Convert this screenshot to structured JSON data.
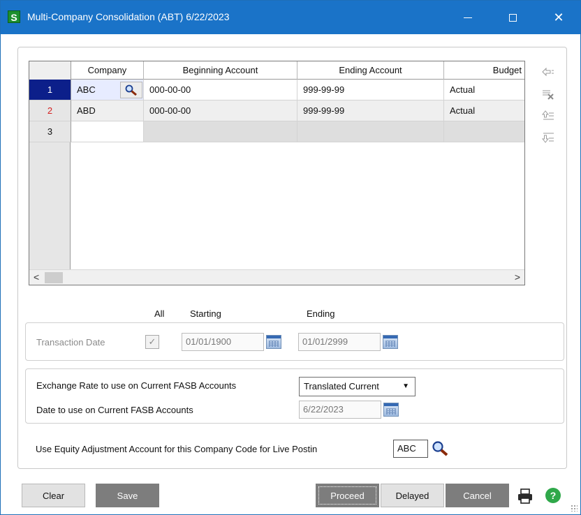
{
  "window": {
    "app_icon_letter": "S",
    "title": "Multi-Company Consolidation (ABT) 6/22/2023",
    "minimize_icon": "minimize-icon",
    "maximize_icon": "maximize-icon",
    "close_glyph": "✕"
  },
  "grid": {
    "columns": [
      "Company",
      "Beginning Account",
      "Ending Account",
      "Budget"
    ],
    "rows": [
      {
        "num": "1",
        "company": "ABC",
        "begin": "000-00-00",
        "end": "999-99-99",
        "budget": "Actual"
      },
      {
        "num": "2",
        "company": "ABD",
        "begin": "000-00-00",
        "end": "999-99-99",
        "budget": "Actual"
      },
      {
        "num": "3",
        "company": "",
        "begin": "",
        "end": "",
        "budget": ""
      }
    ],
    "scroll_left": "<",
    "scroll_right": ">"
  },
  "side_tools": [
    "insert-row-icon",
    "delete-row-icon",
    "move-up-icon",
    "move-down-icon"
  ],
  "date_section": {
    "col_all": "All",
    "col_starting": "Starting",
    "col_ending": "Ending",
    "label": "Transaction Date",
    "all_checked": true,
    "check_glyph": "✓",
    "starting": "01/01/1900",
    "ending": "01/01/2999"
  },
  "fasb": {
    "exchange_label": "Exchange Rate to use on Current FASB Accounts",
    "exchange_value": "Translated Current",
    "date_label": "Date to use on Current FASB Accounts",
    "date_value": "6/22/2023"
  },
  "equity": {
    "label": "Use Equity Adjustment Account for this Company Code for Live Postin",
    "value": "ABC"
  },
  "buttons": {
    "clear": "Clear",
    "save": "Save",
    "proceed": "Proceed",
    "delayed": "Delayed",
    "cancel": "Cancel",
    "help": "?"
  },
  "colors": {
    "titlebar": "#1a73c8",
    "active_row": "#0c1f8a",
    "dark_button": "#7d7d7d",
    "help": "#2fa84a"
  }
}
